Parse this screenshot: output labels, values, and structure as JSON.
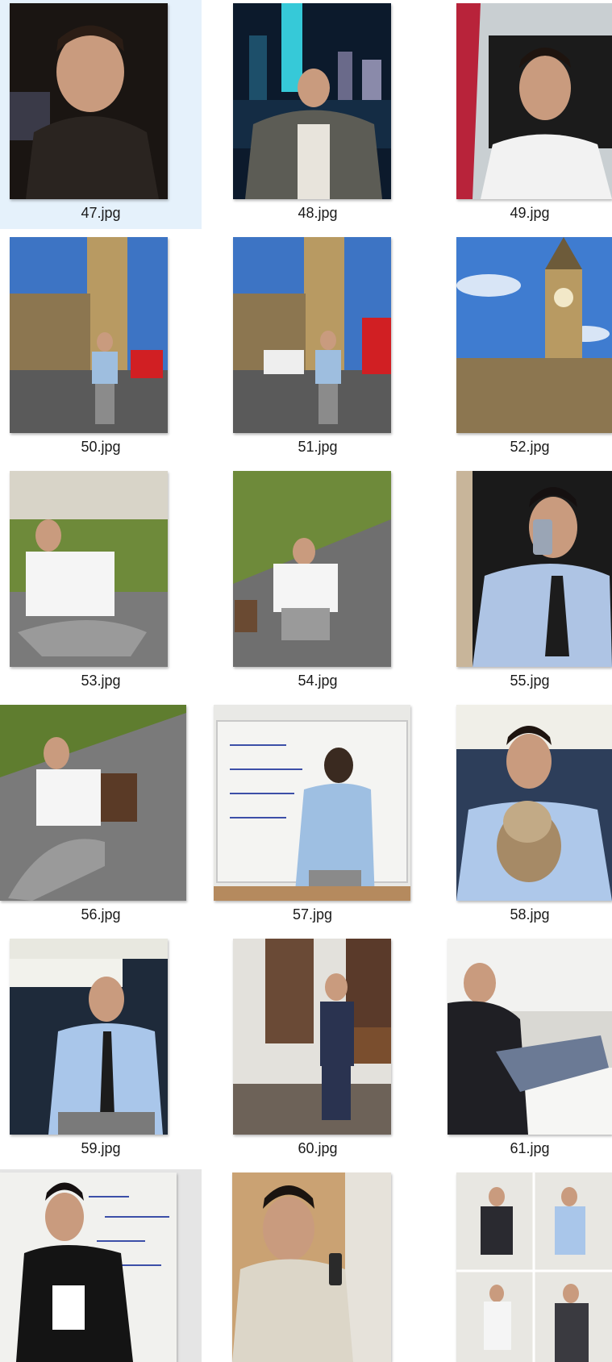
{
  "files": [
    {
      "name": "47.jpg",
      "state": "selected",
      "icon": "photo-thumbnail-icon"
    },
    {
      "name": "48.jpg",
      "state": "normal",
      "icon": "photo-thumbnail-icon"
    },
    {
      "name": "49.jpg",
      "state": "normal",
      "icon": "photo-thumbnail-icon"
    },
    {
      "name": "50.jpg",
      "state": "normal",
      "icon": "photo-thumbnail-icon"
    },
    {
      "name": "51.jpg",
      "state": "normal",
      "icon": "photo-thumbnail-icon"
    },
    {
      "name": "52.jpg",
      "state": "normal",
      "icon": "photo-thumbnail-icon"
    },
    {
      "name": "53.jpg",
      "state": "normal",
      "icon": "photo-thumbnail-icon"
    },
    {
      "name": "54.jpg",
      "state": "normal",
      "icon": "photo-thumbnail-icon"
    },
    {
      "name": "55.jpg",
      "state": "normal",
      "icon": "photo-thumbnail-icon"
    },
    {
      "name": "56.jpg",
      "state": "normal",
      "icon": "photo-thumbnail-icon"
    },
    {
      "name": "57.jpg",
      "state": "normal",
      "icon": "photo-thumbnail-icon"
    },
    {
      "name": "58.jpg",
      "state": "normal",
      "icon": "photo-thumbnail-icon"
    },
    {
      "name": "59.jpg",
      "state": "normal",
      "icon": "photo-thumbnail-icon"
    },
    {
      "name": "60.jpg",
      "state": "normal",
      "icon": "photo-thumbnail-icon"
    },
    {
      "name": "61.jpg",
      "state": "normal",
      "icon": "photo-thumbnail-icon"
    },
    {
      "name": "",
      "state": "hover",
      "icon": "photo-thumbnail-icon"
    },
    {
      "name": "",
      "state": "normal",
      "icon": "photo-thumbnail-icon"
    },
    {
      "name": "",
      "state": "normal",
      "icon": "photo-thumbnail-icon"
    }
  ],
  "colors": {
    "selected_bg": "#e5f1fb",
    "hover_bg": "#e5e5e5",
    "label_text": "#1a1a1a"
  }
}
